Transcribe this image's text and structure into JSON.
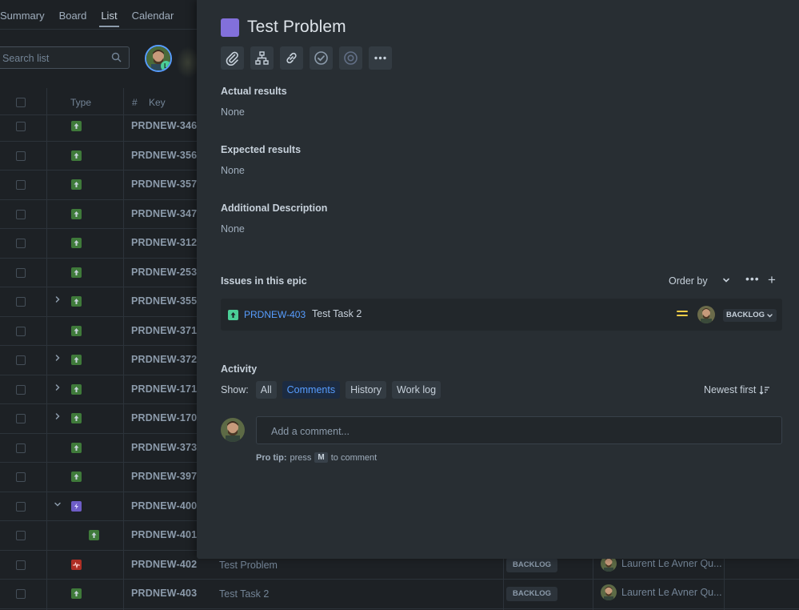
{
  "nav": {
    "tabs": [
      {
        "label": "Summary"
      },
      {
        "label": "Board"
      },
      {
        "label": "List",
        "active": true
      },
      {
        "label": "Calendar"
      }
    ]
  },
  "search": {
    "placeholder": "Search list"
  },
  "table": {
    "headers": {
      "type": "Type",
      "key": "Key"
    },
    "rows": [
      {
        "key": "PRDNEW-346",
        "type": "story"
      },
      {
        "key": "PRDNEW-356",
        "type": "story"
      },
      {
        "key": "PRDNEW-357",
        "type": "story"
      },
      {
        "key": "PRDNEW-347",
        "type": "story"
      },
      {
        "key": "PRDNEW-312",
        "type": "story"
      },
      {
        "key": "PRDNEW-253",
        "type": "story"
      },
      {
        "key": "PRDNEW-355",
        "type": "story",
        "expand": "collapsed"
      },
      {
        "key": "PRDNEW-371",
        "type": "story"
      },
      {
        "key": "PRDNEW-372",
        "type": "story",
        "expand": "collapsed"
      },
      {
        "key": "PRDNEW-171",
        "type": "story",
        "expand": "collapsed"
      },
      {
        "key": "PRDNEW-170",
        "type": "story",
        "expand": "collapsed"
      },
      {
        "key": "PRDNEW-373",
        "type": "story"
      },
      {
        "key": "PRDNEW-397",
        "type": "story"
      },
      {
        "key": "PRDNEW-400",
        "type": "epic",
        "expand": "expanded"
      },
      {
        "key": "PRDNEW-401",
        "type": "story",
        "child": true
      },
      {
        "key": "PRDNEW-402",
        "type": "problem",
        "summary": "Test Problem",
        "status": "BACKLOG",
        "assignee": "Laurent Le Avner Qu..."
      },
      {
        "key": "PRDNEW-403",
        "type": "story",
        "summary": "Test Task 2",
        "status": "BACKLOG",
        "assignee": "Laurent Le Avner Qu..."
      }
    ]
  },
  "issue": {
    "title": "Test Problem",
    "type_color": "#8270db",
    "toolbar_icons": [
      "attachment-icon",
      "child-issues-icon",
      "link-icon",
      "check-circle-icon",
      "target-icon",
      "more-icon"
    ],
    "fields": [
      {
        "label": "Actual results",
        "value": "None"
      },
      {
        "label": "Expected results",
        "value": "None"
      },
      {
        "label": "Additional Description",
        "value": "None"
      }
    ],
    "epic": {
      "label": "Issues in this epic",
      "order_by": "Order by",
      "issues": [
        {
          "key": "PRDNEW-403",
          "summary": "Test Task 2",
          "priority": "medium",
          "status": "BACKLOG"
        }
      ]
    },
    "activity": {
      "label": "Activity",
      "show_label": "Show:",
      "filters": [
        {
          "label": "All"
        },
        {
          "label": "Comments",
          "active": true
        },
        {
          "label": "History"
        },
        {
          "label": "Work log"
        }
      ],
      "sort": "Newest first",
      "comment_placeholder": "Add a comment...",
      "protip": {
        "prefix": "Pro tip:",
        "press": "press",
        "key": "M",
        "suffix": "to comment"
      }
    }
  },
  "colors": {
    "accent": "#579dff",
    "story": "#3f7a3a",
    "epic": "#6e5dc6",
    "problem": "#ae2e24",
    "priority_medium": "#f5cd47"
  }
}
